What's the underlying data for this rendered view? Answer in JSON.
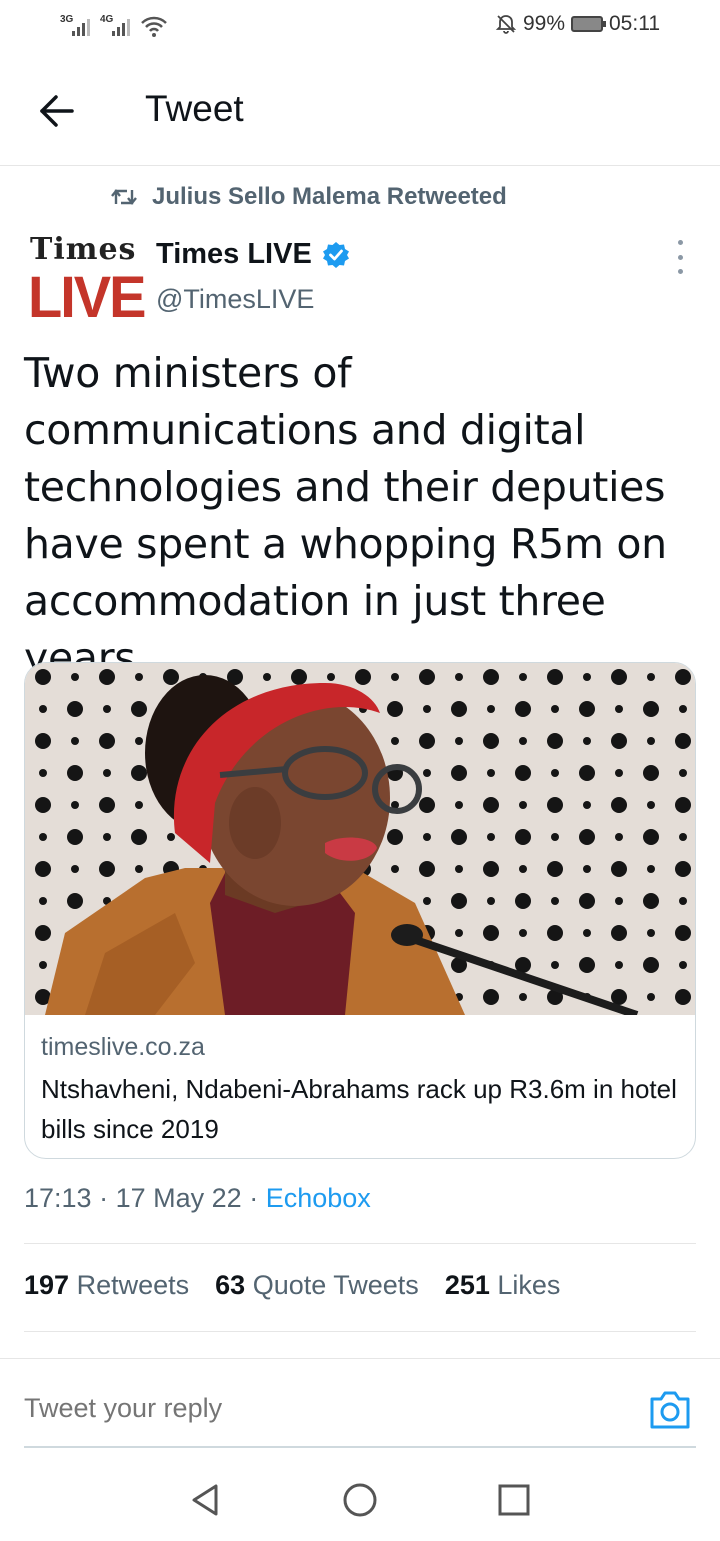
{
  "status_bar": {
    "signal1_label": "3G",
    "signal2_label": "4G",
    "battery": "99%",
    "time": "05:11"
  },
  "header": {
    "title": "Tweet"
  },
  "retweet_context": {
    "label": "Julius Sello Malema Retweeted"
  },
  "author": {
    "avatar_top": "Times",
    "avatar_bottom": "LIVE",
    "name": "Times LIVE",
    "handle": "@TimesLIVE"
  },
  "tweet": {
    "text": "Two ministers of communications and digital technologies and their deputies have spent a whopping R5m on accommodation in just three years."
  },
  "card": {
    "domain": "timeslive.co.za",
    "title": "Ntshavheni, Ndabeni-Abrahams rack up R3.6m in hotel bills since 2019"
  },
  "meta": {
    "time": "17:13",
    "date": "17 May 22",
    "source": "Echobox"
  },
  "stats": {
    "retweets_count": "197",
    "retweets_label": "Retweets",
    "quotes_count": "63",
    "quotes_label": "Quote Tweets",
    "likes_count": "251",
    "likes_label": "Likes"
  },
  "reply": {
    "placeholder": "Tweet your reply"
  },
  "colors": {
    "accent": "#1d9bf0",
    "secondary_text": "#536471",
    "times_live_red": "#c4352a"
  },
  "icons": {
    "back": "arrow-left-icon",
    "retweet": "retweet-icon",
    "verified": "verified-badge-icon",
    "more": "more-vertical-icon",
    "camera": "camera-icon",
    "nav_back": "triangle-back-icon",
    "nav_home": "circle-home-icon",
    "nav_recents": "square-recents-icon"
  }
}
